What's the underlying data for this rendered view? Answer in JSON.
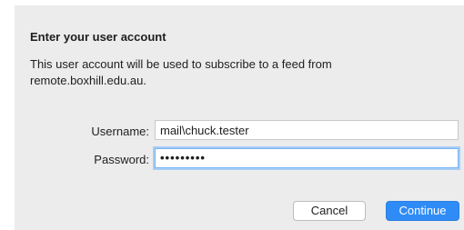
{
  "dialog": {
    "title": "Enter your user account",
    "message": "This user account will be used to subscribe to a feed from remote.boxhill.edu.au."
  },
  "form": {
    "username_label": "Username:",
    "username_value": "mail\\chuck.tester",
    "password_label": "Password:",
    "password_value": "•••••••••"
  },
  "buttons": {
    "cancel_label": "Cancel",
    "continue_label": "Continue"
  },
  "colors": {
    "accent": "#2f8cf6",
    "focus_ring": "#a7cdf7",
    "dialog_bg": "#ececec"
  }
}
